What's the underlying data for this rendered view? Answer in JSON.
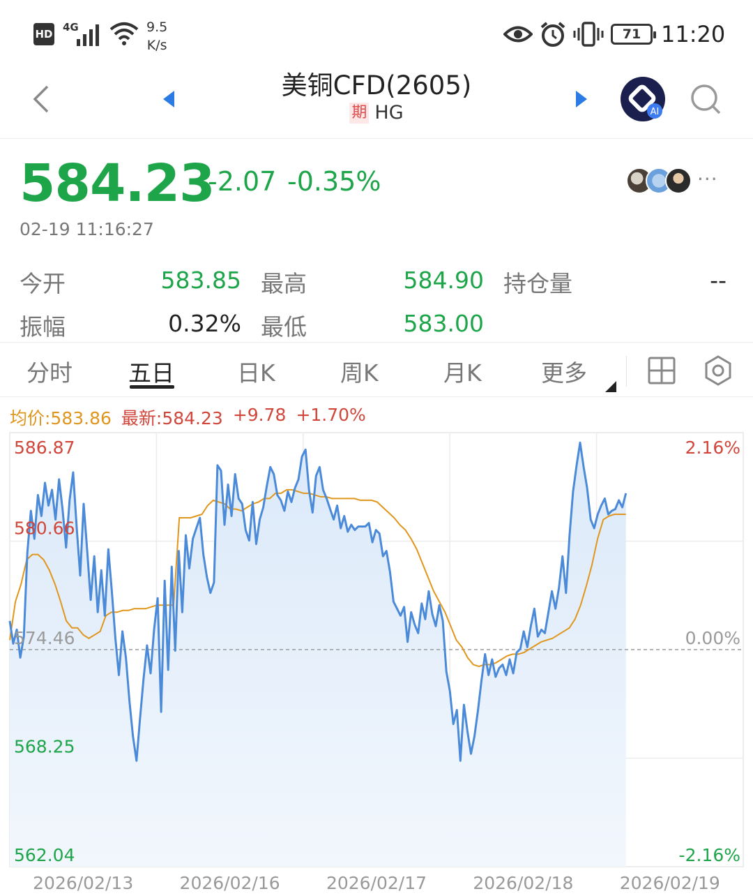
{
  "status_bar": {
    "hd": "HD",
    "network": "4G",
    "speed_value": "9.5",
    "speed_unit": "K/s",
    "battery": "71",
    "time": "11:20",
    "icons": [
      "signal-bars-icon",
      "wifi-icon",
      "eye-icon",
      "alarm-icon",
      "vibrate-icon",
      "battery-icon"
    ]
  },
  "header": {
    "title": "美铜CFD(2605)",
    "badge": "期",
    "code": "HG",
    "ai_badge": "AI",
    "icons": [
      "back-icon",
      "prev-arrow-icon",
      "next-arrow-icon",
      "ai-assistant-icon",
      "search-icon"
    ]
  },
  "quote": {
    "price": "584.23",
    "change": "-2.07",
    "change_pct": "-0.35%",
    "timestamp": "02-19 11:16:27",
    "more": "···",
    "colors": {
      "down": "#1ea54a",
      "up": "#d0463a",
      "avg": "#e0961c",
      "line": "#4a8ad8"
    }
  },
  "stats": {
    "open_label": "今开",
    "open_value": "583.85",
    "high_label": "最高",
    "high_value": "584.90",
    "oi_label": "持仓量",
    "oi_value": "--",
    "amp_label": "振幅",
    "amp_value": "0.32%",
    "low_label": "最低",
    "low_value": "583.00"
  },
  "tabs": {
    "items": [
      "分时",
      "五日",
      "日K",
      "周K",
      "月K",
      "更多"
    ],
    "active": "五日",
    "icons": [
      "grid-layout-icon",
      "settings-gear-icon"
    ]
  },
  "legend": {
    "avg": "均价:583.86",
    "last": "最新:584.23",
    "change": "+9.78",
    "change_pct": "+1.70%"
  },
  "chart_data": {
    "type": "line",
    "title": "",
    "prev_close": 574.46,
    "ylim": [
      562.04,
      586.87
    ],
    "y_ticks_left": [
      "586.87",
      "580.66",
      "574.46",
      "568.25",
      "562.04"
    ],
    "y_ticks_right": [
      "2.16%",
      "0.00%",
      "-2.16%"
    ],
    "x_ticks": [
      "2026/02/13",
      "2026/02/16",
      "2026/02/17",
      "2026/02/18",
      "2026/02/19"
    ],
    "grid": true,
    "series": [
      {
        "name": "最新",
        "values": [
          576.1,
          574.8,
          575.6,
          574.0,
          575.2,
          580.0,
          582.4,
          580.8,
          583.3,
          582.1,
          584.0,
          582.7,
          583.6,
          581.9,
          584.2,
          582.5,
          580.3,
          583.0,
          584.6,
          581.5,
          578.7,
          582.8,
          580.1,
          577.3,
          579.8,
          576.6,
          579.0,
          576.4,
          580.2,
          577.8,
          575.1,
          573.0,
          575.5,
          574.0,
          571.5,
          569.5,
          568.1,
          570.5,
          572.8,
          574.7,
          573.1,
          575.6,
          577.4,
          570.9,
          578.4,
          573.3,
          579.2,
          574.4,
          580.1,
          576.6,
          581.0,
          579.1,
          580.8,
          581.4,
          582.0,
          579.9,
          578.6,
          577.7,
          578.3,
          585.0,
          584.7,
          581.6,
          583.9,
          582.1,
          584.5,
          583.1,
          582.8,
          581.3,
          580.7,
          582.9,
          580.5,
          581.9,
          582.6,
          583.8,
          584.9,
          584.5,
          583.3,
          583.0,
          582.4,
          583.5,
          582.9,
          583.7,
          584.2,
          585.5,
          585.9,
          583.6,
          582.3,
          584.4,
          584.9,
          583.6,
          583.1,
          582.5,
          581.9,
          582.7,
          581.4,
          582.1,
          581.2,
          581.6,
          581.3,
          581.5,
          581.5,
          581.5,
          581.7,
          580.6,
          581.3,
          581.1,
          579.8,
          580.1,
          578.9,
          577.2,
          576.8,
          576.4,
          576.9,
          574.9,
          576.6,
          575.9,
          575.4,
          577.1,
          576.2,
          577.8,
          576.5,
          575.8,
          577.0,
          576.1,
          573.2,
          572.1,
          570.2,
          571.0,
          568.1,
          571.3,
          569.8,
          568.5,
          569.5,
          571.0,
          572.7,
          574.2,
          573.0,
          573.9,
          572.9,
          573.4,
          573.6,
          573.0,
          573.9,
          573.1,
          574.3,
          574.5,
          575.5,
          574.6,
          575.8,
          576.8,
          575.2,
          575.6,
          575.4,
          576.6,
          577.8,
          576.8,
          578.0,
          579.8,
          577.7,
          581.0,
          583.5,
          585.0,
          586.3,
          584.9,
          583.7,
          581.9,
          581.4,
          582.2,
          582.7,
          583.1,
          582.2,
          582.4,
          582.5,
          583.0,
          582.6,
          583.4
        ]
      },
      {
        "name": "均价",
        "values": [
          575.0,
          577.2,
          578.2,
          579.6,
          579.9,
          579.9,
          579.6,
          579.0,
          578.2,
          577.2,
          576.1,
          575.7,
          575.7,
          575.3,
          575.1,
          575.3,
          575.5,
          576.4,
          576.6,
          576.6,
          576.7,
          576.7,
          576.8,
          576.8,
          576.8,
          576.9,
          577.0,
          577.0,
          577.0,
          577.0,
          582.0,
          582.0,
          582.0,
          582.1,
          582.2,
          582.7,
          583.0,
          582.9,
          582.8,
          582.5,
          582.5,
          582.4,
          582.6,
          582.8,
          582.9,
          583.1,
          583.1,
          583.4,
          583.4,
          583.6,
          583.6,
          583.5,
          583.4,
          583.4,
          583.3,
          583.2,
          583.2,
          583.1,
          583.1,
          583.1,
          583.1,
          583.1,
          583.0,
          583.0,
          583.0,
          582.9,
          582.6,
          582.3,
          582.0,
          581.6,
          581.3,
          580.8,
          580.2,
          579.4,
          578.6,
          577.8,
          577.2,
          576.6,
          575.8,
          575.0,
          574.6,
          574.0,
          573.6,
          573.5,
          573.6,
          573.6,
          573.7,
          573.9,
          574.1,
          574.2,
          574.2,
          574.3,
          574.5,
          574.7,
          574.9,
          575.0,
          575.1,
          575.3,
          575.5,
          575.7,
          576.2,
          577.0,
          578.1,
          579.3,
          580.8,
          581.9,
          582.1,
          582.2,
          582.2,
          582.2
        ]
      }
    ]
  }
}
